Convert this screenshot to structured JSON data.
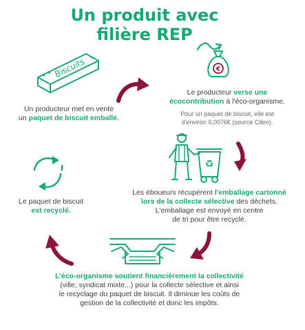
{
  "title": {
    "line1": "Un produit avec",
    "line2": "filière REP"
  },
  "package_label": "Biscuits",
  "step_producer_sells": {
    "pre": "Un producteur met en vente",
    "pre2": "un ",
    "bold": "paquet de biscuit emballé",
    "post": "."
  },
  "step_contribution": {
    "pre": "Le producteur ",
    "bold": "verse une",
    "bold2": "écocontribution",
    "post": " à l'éco-organisme.",
    "note1": "Pour un paquet de biscuit, elle est",
    "note2": "d'environ 0,0076€ (source Citeo)."
  },
  "step_collection": {
    "pre": "Les éboueurs récupèrent ",
    "bold1": "l'emballage cartonné",
    "bold2": "lors de la collecte sélective",
    "post": " des déchets.",
    "line3": "L'emballage est envoyé en centre",
    "line4": "de tri pour être recyclé."
  },
  "step_recycled": {
    "pre": "Le paquet de biscuit",
    "bold": "est recyclé."
  },
  "step_funding": {
    "bold": "L'éco-organisme soutient financièrement la collectivité",
    "line2": "(ville, syndicat mixte...) pour la collecte sélective et ainsi",
    "line3": "le recyclage du paquet de biscuit. Il diminue les coûts de",
    "line4": "gestion de la collectivité et donc les impôts."
  },
  "colors": {
    "green": "#17a874",
    "arrow": "#8b1538",
    "text": "#3f3a3b",
    "grey": "#6b6669"
  }
}
